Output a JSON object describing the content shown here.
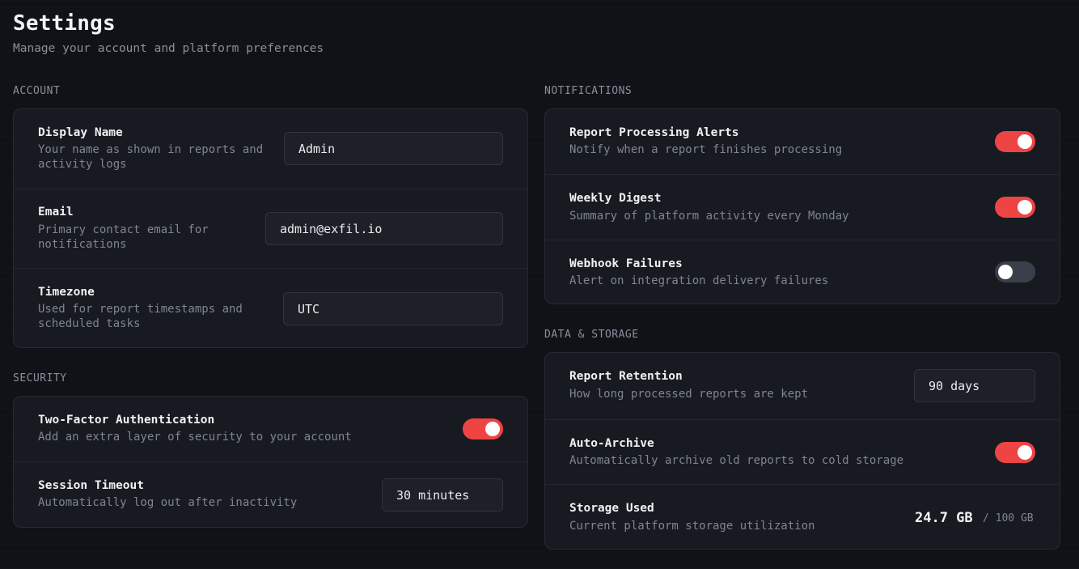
{
  "header": {
    "title": "Settings",
    "subtitle": "Manage your account and platform preferences"
  },
  "account": {
    "section_label": "ACCOUNT",
    "display_name": {
      "label": "Display Name",
      "desc_line1": "Your name as shown in reports and",
      "desc_line2": "activity logs",
      "value": "Admin"
    },
    "email": {
      "label": "Email",
      "desc_line1": "Primary contact email for",
      "desc_line2": "notifications",
      "value": "admin@exfil.io"
    },
    "timezone": {
      "label": "Timezone",
      "desc_line1": "Used for report timestamps and",
      "desc_line2": "scheduled tasks",
      "value": "UTC"
    }
  },
  "security": {
    "section_label": "SECURITY",
    "two_factor": {
      "label": "Two-Factor Authentication",
      "desc": "Add an extra layer of security to your account",
      "enabled": true
    },
    "session_timeout": {
      "label": "Session Timeout",
      "desc": "Automatically log out after inactivity",
      "value": "30 minutes"
    }
  },
  "notifications": {
    "section_label": "NOTIFICATIONS",
    "report_alerts": {
      "label": "Report Processing Alerts",
      "desc": "Notify when a report finishes processing",
      "enabled": true
    },
    "weekly_digest": {
      "label": "Weekly Digest",
      "desc": "Summary of platform activity every Monday",
      "enabled": true
    },
    "webhook_failures": {
      "label": "Webhook Failures",
      "desc": "Alert on integration delivery failures",
      "enabled": false
    }
  },
  "data_storage": {
    "section_label": "DATA & STORAGE",
    "retention": {
      "label": "Report Retention",
      "desc": "How long processed reports are kept",
      "value": "90 days"
    },
    "auto_archive": {
      "label": "Auto-Archive",
      "desc": "Automatically archive old reports to cold storage",
      "enabled": true
    },
    "storage_used": {
      "label": "Storage Used",
      "desc": "Current platform storage utilization",
      "used": "24.7 GB",
      "total": "/ 100 GB"
    }
  },
  "colors": {
    "accent": "#ef4444",
    "toggle_off": "#3a3f4b",
    "card_bg": "#171a20",
    "page_bg": "#0f1116"
  }
}
